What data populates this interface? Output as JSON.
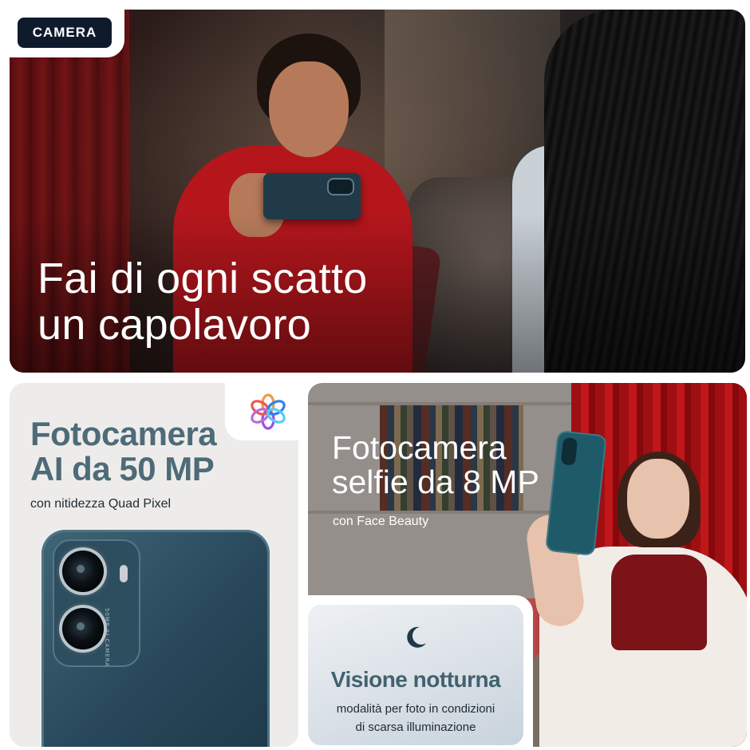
{
  "badge": {
    "label": "CAMERA"
  },
  "hero": {
    "title_line1": "Fai di ogni scatto",
    "title_line2": "un capolavoro"
  },
  "main_camera": {
    "heading_line1": "Fotocamera",
    "heading_line2": "AI da 50 MP",
    "subtitle": "con nitidezza Quad Pixel",
    "icon": "ai-flower-icon",
    "camera_label": "50MP AI CAMERA"
  },
  "selfie_camera": {
    "heading_line1": "Fotocamera",
    "heading_line2": "selfie da 8 MP",
    "subtitle": "con Face Beauty"
  },
  "night_vision": {
    "icon": "moon-icon",
    "title": "Visione notturna",
    "desc_line1": "modalità per foto in condizioni",
    "desc_line2": "di scarsa illuminazione"
  },
  "colors": {
    "badge_bg": "#0f1b2d",
    "accent_teal": "#4d6b78",
    "phone_teal": "#28475a"
  }
}
